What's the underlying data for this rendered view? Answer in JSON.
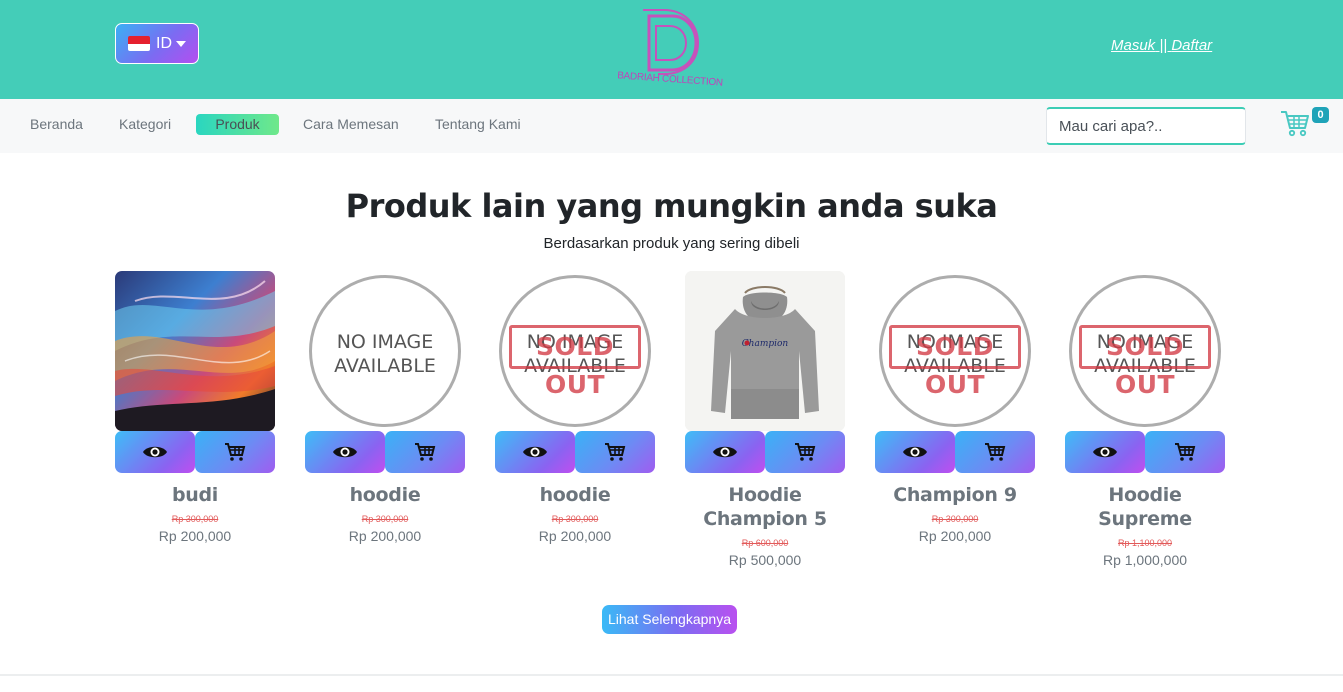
{
  "header": {
    "language": "ID",
    "brand": "BADRIAH COLLECTION",
    "login": "Masuk",
    "separator": " || ",
    "register": "Daftar"
  },
  "nav": {
    "items": [
      {
        "label": "Beranda",
        "active": false
      },
      {
        "label": "Kategori",
        "active": false
      },
      {
        "label": "Produk",
        "active": true
      },
      {
        "label": "Cara Memesan",
        "active": false
      },
      {
        "label": "Tentang Kami",
        "active": false
      }
    ],
    "search_placeholder": "Mau cari apa?..",
    "cart_count": "0"
  },
  "main": {
    "title": "Produk lain yang mungkin anda suka",
    "subtitle": "Berdasarkan produk yang sering dibeli",
    "no_image_text": "NO IMAGE AVAILABLE",
    "sold_out_text": "SOLD OUT",
    "products": [
      {
        "name": "budi",
        "old_price": "Rp 300,000",
        "price": "Rp 200,000",
        "image": "painting",
        "sold_out": false
      },
      {
        "name": "hoodie",
        "old_price": "Rp 300,000",
        "price": "Rp 200,000",
        "image": "none",
        "sold_out": false
      },
      {
        "name": "hoodie",
        "old_price": "Rp 300,000",
        "price": "Rp 200,000",
        "image": "none",
        "sold_out": true
      },
      {
        "name": "Hoodie Champion 5",
        "old_price": "Rp 600,000",
        "price": "Rp 500,000",
        "image": "hoodie",
        "sold_out": false
      },
      {
        "name": "Champion 9",
        "old_price": "Rp 300,000",
        "price": "Rp 200,000",
        "image": "none",
        "sold_out": true
      },
      {
        "name": "Hoodie Supreme",
        "old_price": "Rp 1,100,000",
        "price": "Rp 1,000,000",
        "image": "none",
        "sold_out": true
      }
    ],
    "more_button": "Lihat Selengkapnya"
  },
  "colors": {
    "header_bg": "#44cdb8",
    "accent_purple": "#b44ef0",
    "accent_blue": "#3ab0f5",
    "sold_out_red": "#d23a45"
  }
}
